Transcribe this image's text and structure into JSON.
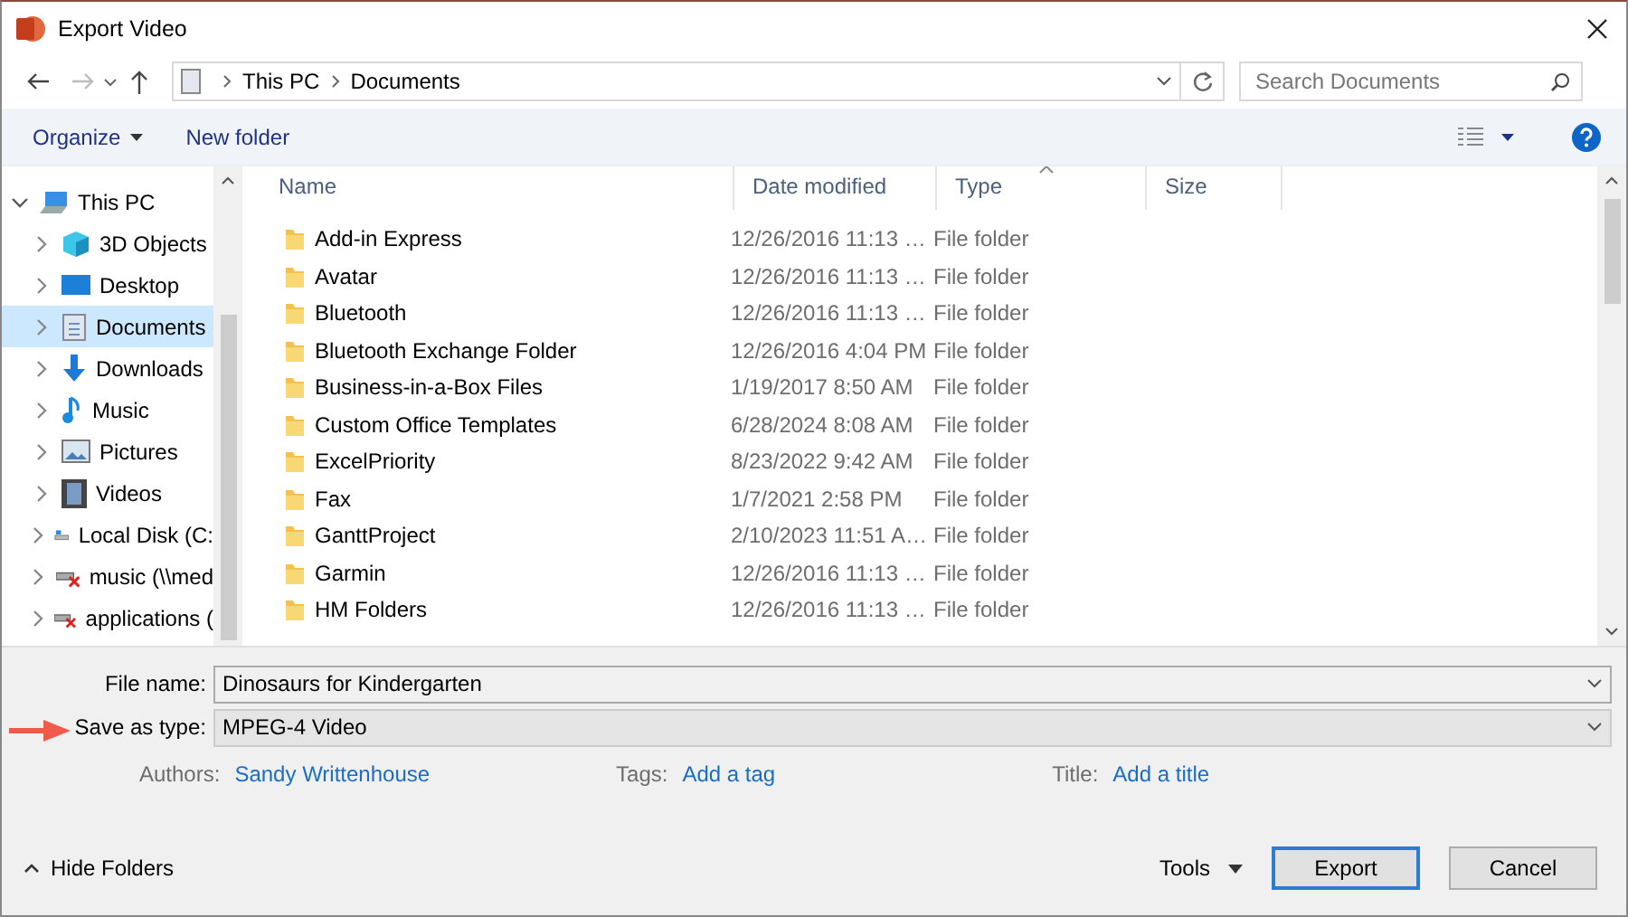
{
  "window": {
    "title": "Export Video"
  },
  "address": {
    "path": [
      "This PC",
      "Documents"
    ]
  },
  "search": {
    "placeholder": "Search Documents"
  },
  "toolbar": {
    "organize": "Organize",
    "new_folder": "New folder"
  },
  "nav": {
    "items": [
      {
        "label": "This PC",
        "expanded": true,
        "selected": false,
        "children": [
          {
            "label": "3D Objects",
            "expanded": false,
            "selected": false
          },
          {
            "label": "Desktop",
            "expanded": false,
            "selected": false
          },
          {
            "label": "Documents",
            "expanded": false,
            "selected": true
          },
          {
            "label": "Downloads",
            "expanded": false,
            "selected": false
          },
          {
            "label": "Music",
            "expanded": false,
            "selected": false
          },
          {
            "label": "Pictures",
            "expanded": false,
            "selected": false
          },
          {
            "label": "Videos",
            "expanded": false,
            "selected": false
          },
          {
            "label": "Local Disk (C:",
            "expanded": false,
            "selected": false
          },
          {
            "label": "music (\\\\med",
            "expanded": false,
            "selected": false
          },
          {
            "label": "applications (",
            "expanded": false,
            "selected": false
          }
        ]
      }
    ]
  },
  "columns": [
    {
      "label": "Name",
      "sorted": false
    },
    {
      "label": "Date modified",
      "sorted": false
    },
    {
      "label": "Type",
      "sorted": true
    },
    {
      "label": "Size",
      "sorted": false
    }
  ],
  "rows": [
    {
      "name": "Add-in Express",
      "date": "12/26/2016 11:13 …",
      "type": "File folder"
    },
    {
      "name": "Avatar",
      "date": "12/26/2016 11:13 …",
      "type": "File folder"
    },
    {
      "name": "Bluetooth",
      "date": "12/26/2016 11:13 …",
      "type": "File folder"
    },
    {
      "name": "Bluetooth Exchange Folder",
      "date": "12/26/2016 4:04 PM",
      "type": "File folder"
    },
    {
      "name": "Business-in-a-Box Files",
      "date": "1/19/2017 8:50 AM",
      "type": "File folder"
    },
    {
      "name": "Custom Office Templates",
      "date": "6/28/2024 8:08 AM",
      "type": "File folder"
    },
    {
      "name": "ExcelPriority",
      "date": "8/23/2022 9:42 AM",
      "type": "File folder"
    },
    {
      "name": "Fax",
      "date": "1/7/2021 2:58 PM",
      "type": "File folder"
    },
    {
      "name": "GanttProject",
      "date": "2/10/2023 11:51 A…",
      "type": "File folder"
    },
    {
      "name": "Garmin",
      "date": "12/26/2016 11:13 …",
      "type": "File folder"
    },
    {
      "name": "HM Folders",
      "date": "12/26/2016 11:13 …",
      "type": "File folder"
    }
  ],
  "file_name": {
    "label": "File name:",
    "value": "Dinosaurs for Kindergarten"
  },
  "save_type": {
    "label": "Save as type:",
    "value": "MPEG-4 Video"
  },
  "meta": [
    {
      "label": "Authors:",
      "value": "Sandy Writtenhouse"
    },
    {
      "label": "Tags:",
      "value": "Add a tag"
    },
    {
      "label": "Title:",
      "value": "Add a title"
    }
  ],
  "hide_folders": "Hide Folders",
  "tools": "Tools",
  "buttons": [
    {
      "label": "Export",
      "default": true
    },
    {
      "label": "Cancel",
      "default": false
    }
  ]
}
